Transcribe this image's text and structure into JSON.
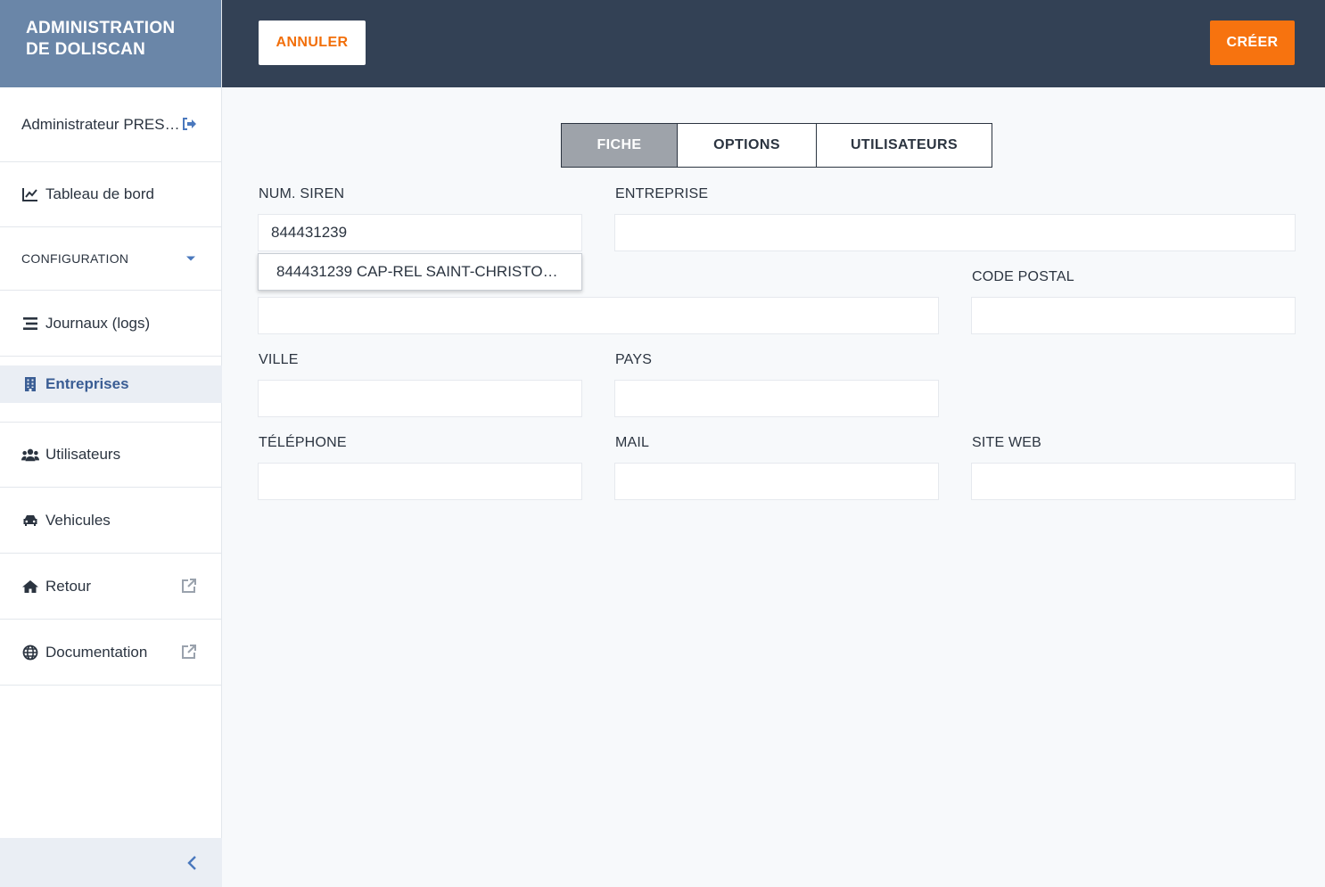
{
  "app": {
    "title": "ADMINISTRATION DE DOLISCAN"
  },
  "sidebar": {
    "user": "Administrateur PRES…",
    "items": [
      {
        "label": "Tableau de bord",
        "icon": "chart-line-icon"
      },
      {
        "label": "CONFIGURATION",
        "icon": "caret-down-icon"
      },
      {
        "label": "Journaux (logs)",
        "icon": "list-icon"
      },
      {
        "label": "Entreprises",
        "icon": "building-icon",
        "active": true
      },
      {
        "label": "Utilisateurs",
        "icon": "users-icon"
      },
      {
        "label": "Vehicules",
        "icon": "car-icon"
      },
      {
        "label": "Retour",
        "icon": "home-icon"
      },
      {
        "label": "Documentation",
        "icon": "globe-icon"
      }
    ]
  },
  "toolbar": {
    "cancel_label": "ANNULER",
    "create_label": "CRÉER"
  },
  "tabs": [
    {
      "label": "FICHE",
      "active": true
    },
    {
      "label": "OPTIONS"
    },
    {
      "label": "UTILISATEURS"
    }
  ],
  "form": {
    "siren": {
      "label": "NUM. SIREN",
      "value": "844431239"
    },
    "entreprise": {
      "label": "ENTREPRISE",
      "value": ""
    },
    "adresse": {
      "value": ""
    },
    "code_postal": {
      "label": "CODE POSTAL",
      "value": ""
    },
    "ville": {
      "label": "VILLE",
      "value": ""
    },
    "pays": {
      "label": "PAYS",
      "value": ""
    },
    "telephone": {
      "label": "TÉLÉPHONE",
      "value": ""
    },
    "mail": {
      "label": "MAIL",
      "value": ""
    },
    "site_web": {
      "label": "SITE WEB",
      "value": ""
    },
    "suggestion": "844431239 CAP-REL SAINT-CHRISTOL…"
  },
  "colors": {
    "accent": "#f7730f",
    "topbar": "#334155",
    "brand": "#6a86a8",
    "active_nav": "#3a5d94"
  }
}
